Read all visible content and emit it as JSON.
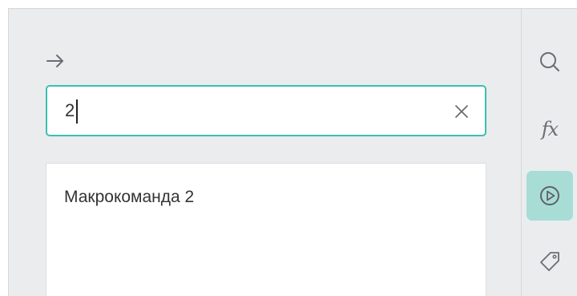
{
  "search": {
    "value": "2",
    "back_icon": "arrow-right-icon",
    "clear_icon": "close-icon"
  },
  "results": [
    {
      "label": "Макрокоманда 2"
    }
  ],
  "sidebar": {
    "items": [
      {
        "name": "search",
        "icon": "search-icon",
        "active": false
      },
      {
        "name": "functions",
        "icon": "fx-icon",
        "label": "fx",
        "active": false
      },
      {
        "name": "macros",
        "icon": "play-circle-icon",
        "active": true
      },
      {
        "name": "tags",
        "icon": "tag-icon",
        "active": false
      }
    ]
  },
  "colors": {
    "panel_bg": "#ebecee",
    "accent": "#3bbfb0",
    "active_bg": "#a8ddd6",
    "icon": "#6a6d72",
    "text": "#333333"
  }
}
